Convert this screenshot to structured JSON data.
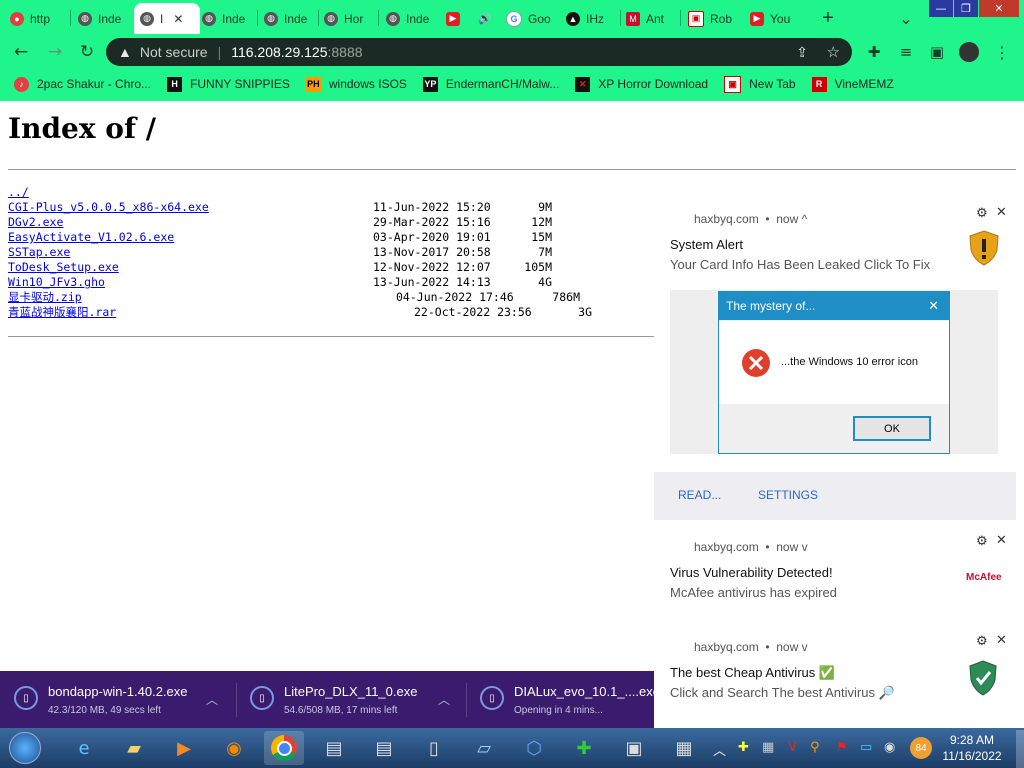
{
  "browser": {
    "tabs": [
      {
        "label": "http",
        "active": false
      },
      {
        "label": "Inde",
        "active": false
      },
      {
        "label": "I",
        "active": true
      },
      {
        "label": "Inde",
        "active": false
      },
      {
        "label": "Inde",
        "active": false
      },
      {
        "label": "Hor",
        "active": false
      },
      {
        "label": "Inde",
        "active": false
      },
      {
        "label": "",
        "active": false
      },
      {
        "label": "",
        "active": false
      },
      {
        "label": "Goo",
        "active": false
      },
      {
        "label": "IHz",
        "active": false
      },
      {
        "label": "Ant",
        "active": false
      },
      {
        "label": "Rob",
        "active": false
      },
      {
        "label": "You",
        "active": false
      }
    ],
    "new_tab": "+",
    "tab_search": "⌄",
    "window_controls": {
      "minimize": "—",
      "maximize": "❐",
      "close": "✕"
    },
    "security_label": "Not secure",
    "url_host": "116.208.29.125",
    "url_port": ":8888",
    "bookmarks": [
      {
        "label": "2pac Shakur - Chro...",
        "icon": "music-icon"
      },
      {
        "label": "FUNNY SNIPPIES",
        "icon": "h-icon"
      },
      {
        "label": "windows ISOS",
        "icon": "ph-icon"
      },
      {
        "label": "EndermanCH/Malw...",
        "icon": "yp-icon"
      },
      {
        "label": "XP Horror Download",
        "icon": "x-icon"
      },
      {
        "label": "New Tab",
        "icon": "newtab-icon"
      },
      {
        "label": "VineMEMZ",
        "icon": "r-icon"
      }
    ]
  },
  "page": {
    "title": "Index of /",
    "parent_link": "../",
    "files": [
      {
        "name": "CGI-Plus_v5.0.0.5_x86-x64.exe",
        "date": "11-Jun-2022 15:20",
        "size": "9M"
      },
      {
        "name": "DGv2.exe",
        "date": "29-Mar-2022 15:16",
        "size": "12M"
      },
      {
        "name": "EasyActivate_V1.02.6.exe",
        "date": "03-Apr-2020 19:01",
        "size": "15M"
      },
      {
        "name": "SSTap.exe",
        "date": "13-Nov-2017 20:58",
        "size": "7M"
      },
      {
        "name": "ToDesk_Setup.exe",
        "date": "12-Nov-2022 12:07",
        "size": "105M"
      },
      {
        "name": "Win10_JFv3.gho",
        "date": "13-Jun-2022 14:13",
        "size": "4G"
      },
      {
        "name": "显卡驱动.zip",
        "date": "04-Jun-2022 17:46",
        "size": "786M"
      },
      {
        "name": "青蓝战神版襄阳.rar",
        "date": "22-Oct-2022 23:56",
        "size": "3G"
      }
    ]
  },
  "notifications": [
    {
      "source": "haxbyq.com",
      "time": "now",
      "caret": "^",
      "title": "System Alert",
      "message": "Your Card Info Has Been Leaked Click To Fix",
      "icon": "warning-shield-icon",
      "image_dialog": {
        "title": "The mystery of...",
        "text": "...the Windows 10 error icon",
        "button": "OK"
      },
      "actions": [
        "READ...",
        "SETTINGS"
      ]
    },
    {
      "source": "haxbyq.com",
      "time": "now",
      "caret": "v",
      "title": "Virus Vulnerability Detected!",
      "message": "McAfee antivirus has expired",
      "icon": "mcafee-icon",
      "icon_text": "McAfee"
    },
    {
      "source": "haxbyq.com",
      "time": "now",
      "caret": "v",
      "title": "The best Cheap Antivirus ✅",
      "message": "Click and Search The best Antivirus 🔎",
      "icon": "green-shield-icon"
    }
  ],
  "downloads": [
    {
      "name": "bondapp-win-1.40.2.exe",
      "status": "42.3/120 MB, 49 secs left"
    },
    {
      "name": "LitePro_DLX_11_0.exe",
      "status": "54.6/508 MB, 17 mins left"
    },
    {
      "name": "DIALux_evo_10.1_....exe",
      "status": "Opening in 4 mins..."
    }
  ],
  "taskbar": {
    "tray_badge": "84",
    "time": "9:28 AM",
    "date": "11/16/2022"
  },
  "colors": {
    "chrome_bg": "#1ff58a",
    "omnibox_bg": "#1b2a24",
    "download_bar": "#3a1b6e",
    "link": "#0000ee",
    "dialog_title": "#1f8ec7",
    "action_text": "#2a67c8"
  }
}
